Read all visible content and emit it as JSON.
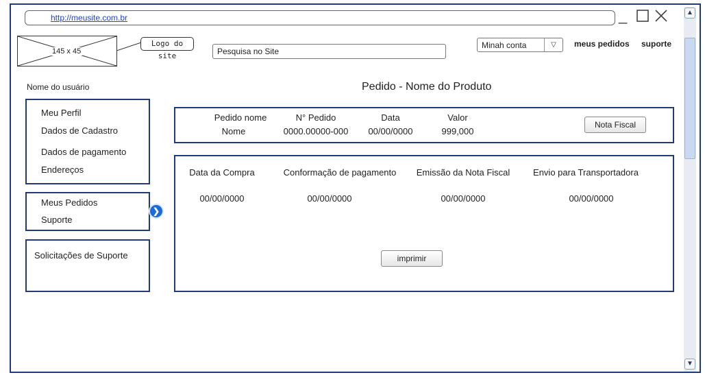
{
  "browser": {
    "url": "http://meusite.com.br",
    "minimize_icon": "minimize-icon",
    "maximize_icon": "maximize-icon",
    "close_icon": "close-icon"
  },
  "header": {
    "logo_placeholder": "145 x 45",
    "logo_callout": "Logo do site",
    "search_placeholder": "Pesquisa no Site",
    "account_select": "Minah conta",
    "links": [
      "meus pedidos",
      "suporte"
    ]
  },
  "sidebar": {
    "username": "Nome do usuário",
    "group1": [
      "Meu Perfil",
      "Dados de Cadastro",
      "Dados de pagamento",
      "Endereços"
    ],
    "group2": [
      "Meus Pedidos",
      "Suporte"
    ],
    "group3": [
      "Solicitações de Suporte"
    ]
  },
  "main": {
    "title": "Pedido - Nome do Produto",
    "order": {
      "headers": [
        "Pedido nome",
        "N° Pedido",
        "Data",
        "Valor"
      ],
      "values": [
        "Nome",
        "0000.00000-000",
        "00/00/0000",
        "999,000"
      ],
      "invoice_button": "Nota Fiscal"
    },
    "status": {
      "headers": [
        "Data da Compra",
        "Conformação de pagamento",
        "Emissão da Nota Fiscal",
        "Envio para Transportadora"
      ],
      "values": [
        "00/00/0000",
        "00/00/0000",
        "00/00/0000",
        "00/00/0000"
      ],
      "print_button": "imprimir"
    }
  }
}
